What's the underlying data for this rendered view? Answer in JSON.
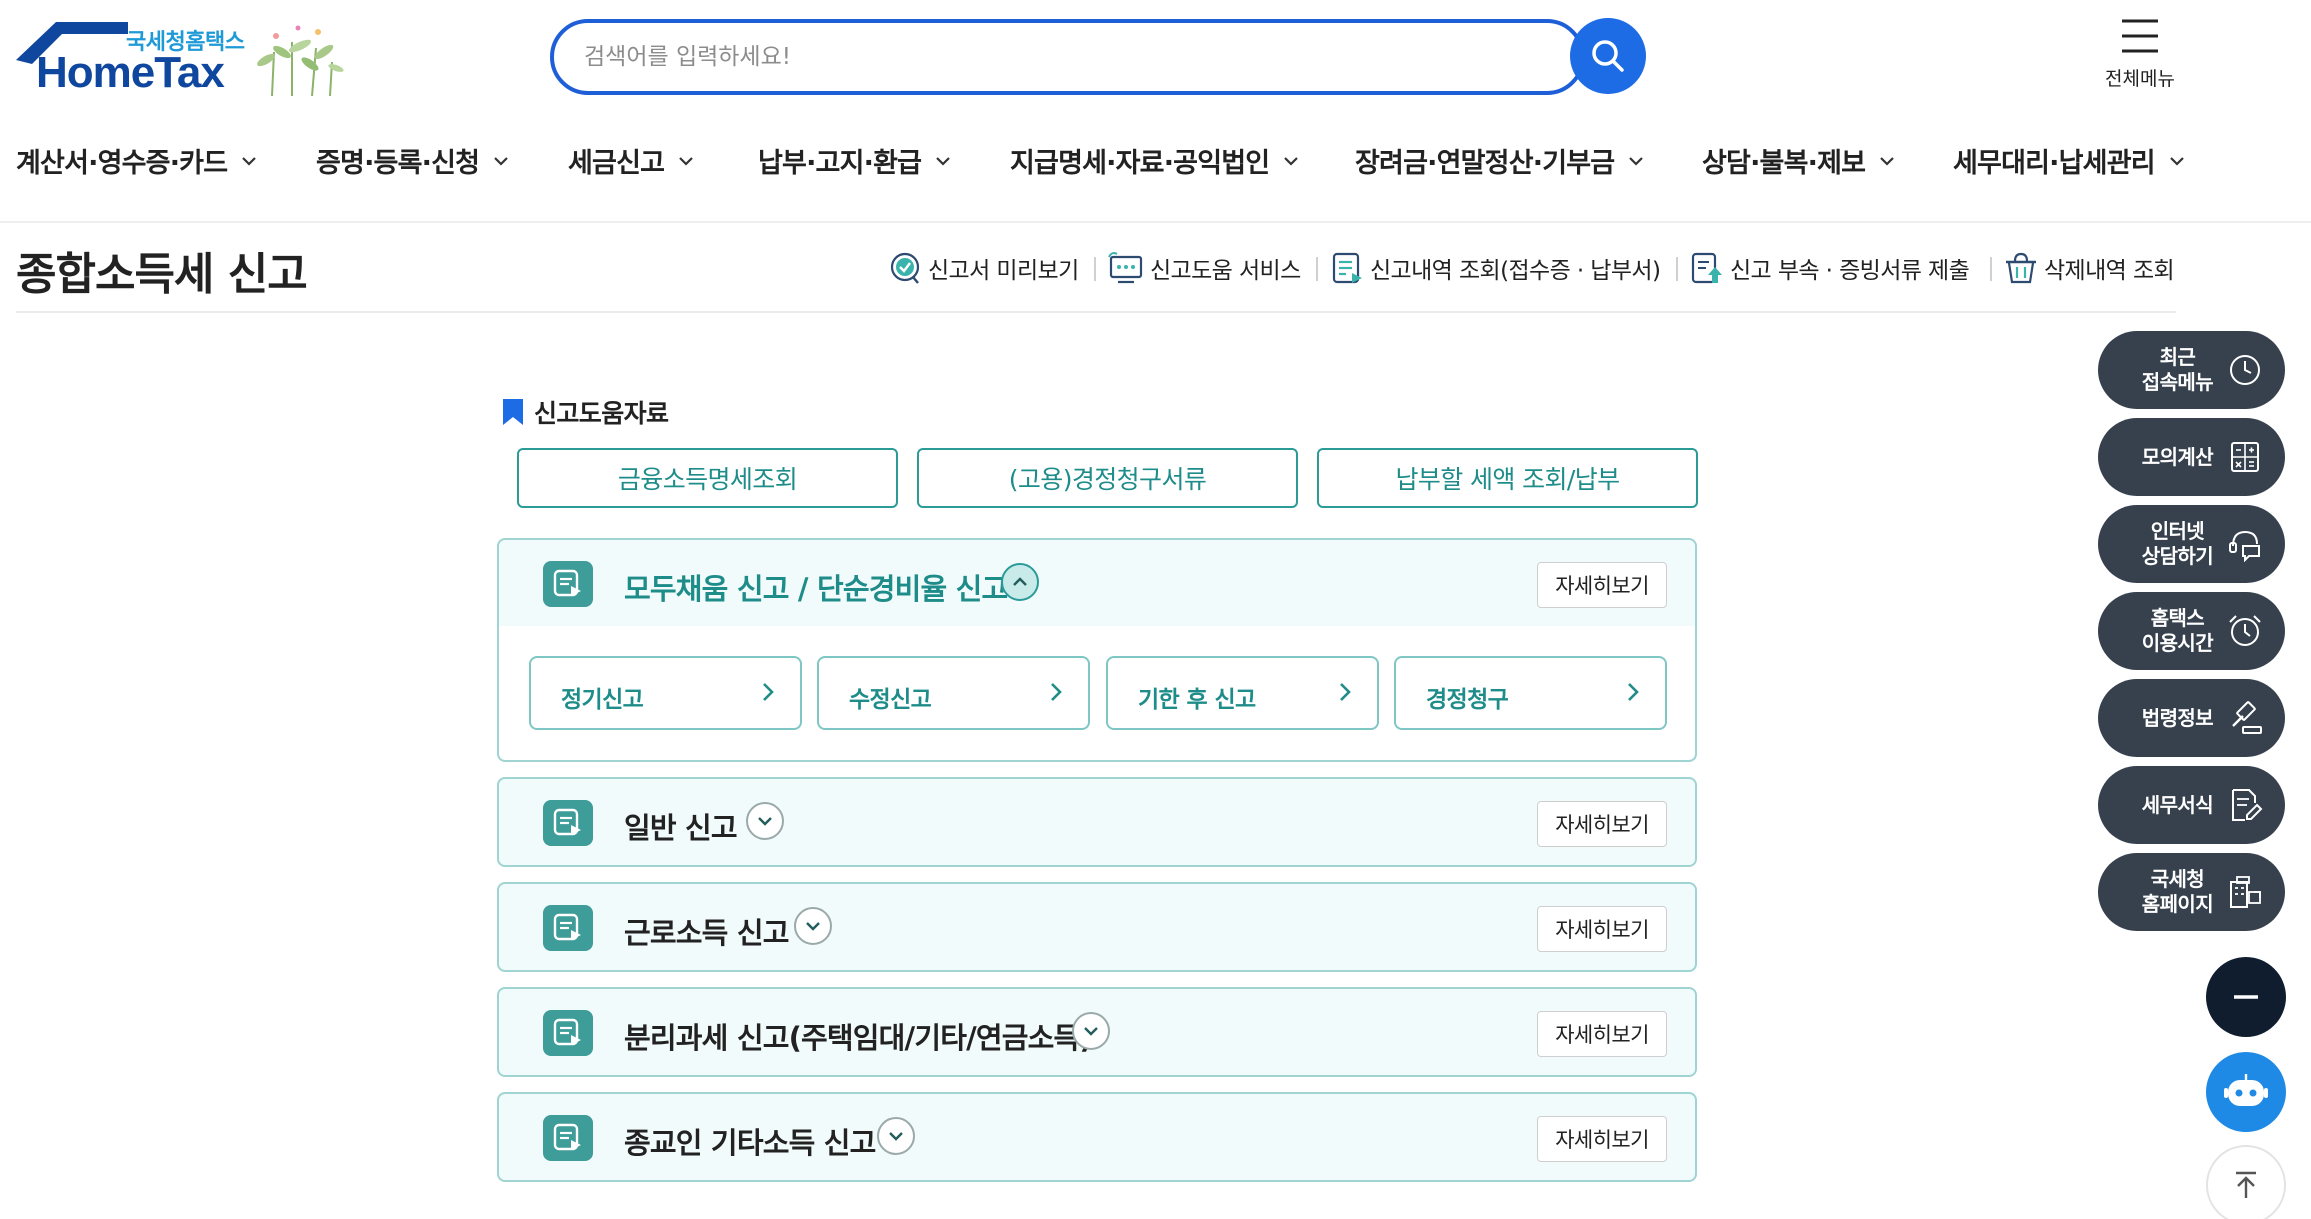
{
  "brand": {
    "sub": "국세청홈택스",
    "name": "HomeTax",
    "colors": {
      "primary": "#10479e",
      "accent": "#1e9ad6",
      "teal": "#2b9b98"
    }
  },
  "search": {
    "placeholder": "검색어를 입력하세요!",
    "value": ""
  },
  "all_menu": {
    "label": "전체메뉴"
  },
  "gnb": [
    {
      "label": "계산서·영수증·카드"
    },
    {
      "label": "증명·등록·신청"
    },
    {
      "label": "세금신고"
    },
    {
      "label": "납부·고지·환급"
    },
    {
      "label": "지급명세·자료·공익법인"
    },
    {
      "label": "장려금·연말정산·기부금"
    },
    {
      "label": "상담·불복·제보"
    },
    {
      "label": "세무대리·납세관리"
    }
  ],
  "page": {
    "title": "종합소득세 신고"
  },
  "utils": [
    {
      "label": "신고서 미리보기",
      "icon": "check-badge-icon"
    },
    {
      "label": "신고도움 서비스",
      "icon": "monitor-person-icon"
    },
    {
      "label": "신고내역 조회(접수증 · 납부서)",
      "icon": "document-list-icon"
    },
    {
      "label": "신고 부속 · 증빙서류 제출",
      "icon": "document-upload-icon"
    },
    {
      "label": "삭제내역 조회",
      "icon": "trash-basket-icon"
    }
  ],
  "help": {
    "heading": "신고도움자료",
    "buttons": [
      {
        "label": "금융소득명세조회"
      },
      {
        "label": "(고용)경정청구서류"
      },
      {
        "label": "납부할 세액 조회/납부"
      }
    ]
  },
  "panels": [
    {
      "title": "모두채움 신고 / 단순경비율 신고",
      "detail": "자세히보기",
      "expanded": true,
      "actions": [
        {
          "label": "정기신고"
        },
        {
          "label": "수정신고"
        },
        {
          "label": "기한 후 신고"
        },
        {
          "label": "경정청구"
        }
      ]
    },
    {
      "title": "일반 신고",
      "detail": "자세히보기",
      "expanded": false
    },
    {
      "title": "근로소득 신고",
      "detail": "자세히보기",
      "expanded": false
    },
    {
      "title": "분리과세 신고(주택임대/기타/연금소득)",
      "detail": "자세히보기",
      "expanded": false
    },
    {
      "title": "종교인 기타소득 신고",
      "detail": "자세히보기",
      "expanded": false
    }
  ],
  "side_menu": [
    {
      "label": "최근\n접속메뉴",
      "icon": "clock-icon"
    },
    {
      "label": "모의계산",
      "icon": "calculator-icon"
    },
    {
      "label": "인터넷\n상담하기",
      "icon": "chat-headset-icon"
    },
    {
      "label": "홈택스\n이용시간",
      "icon": "alarm-clock-icon"
    },
    {
      "label": "법령정보",
      "icon": "gavel-icon"
    },
    {
      "label": "세무서식",
      "icon": "form-edit-icon"
    },
    {
      "label": "국세청\n홈페이지",
      "icon": "building-link-icon"
    }
  ]
}
